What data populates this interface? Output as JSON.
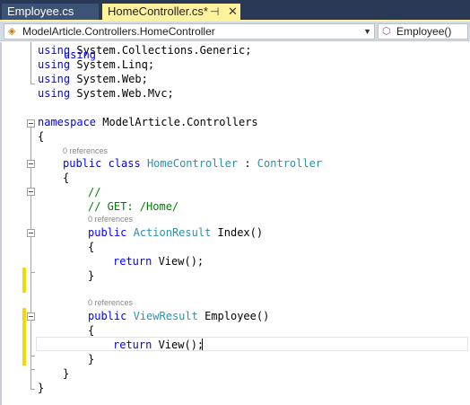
{
  "tabs": [
    {
      "label": "Employee.cs",
      "active": false
    },
    {
      "label": "HomeController.cs*",
      "active": true,
      "pin_glyph": "⊣",
      "close_glyph": "✕"
    }
  ],
  "navbar": {
    "class_combo": {
      "text": "ModelArticle.Controllers.HomeController",
      "icon": "class-icon"
    },
    "member_combo": {
      "text": "Employee()",
      "icon": "method-icon"
    }
  },
  "colors": {
    "keyword": "#0000ff",
    "type": "#2b91af",
    "comment": "#008000",
    "text": "#000000",
    "annotation": "#888888",
    "tab_active": "#fff29d",
    "tab_strip": "#293955",
    "change_bar": "#efdb00"
  },
  "editor": {
    "code": {
      "using1": {
        "kw": "using",
        "rest": " System.Collections.Generic;"
      },
      "using2": {
        "kw": "using",
        "rest": " System.Linq;"
      },
      "using3": {
        "kw": "using",
        "rest": " System.Web;"
      },
      "using4": {
        "kw": "using",
        "rest": " System.Web.Mvc;"
      },
      "ns": {
        "kw": "namespace",
        "rest": " ModelArticle.Controllers"
      },
      "ns_open": "{",
      "class": {
        "kw1": "public",
        "kw2": " class",
        "name": "HomeController",
        "sep": " : ",
        "base": "Controller"
      },
      "class_open": "{",
      "comment1": "//",
      "comment2": "// GET: /Home/",
      "index_sig": {
        "kw": "public",
        "type": "ActionResult",
        "rest": " Index()"
      },
      "index_open": "{",
      "index_return": {
        "kw": "return",
        "rest": " View();"
      },
      "index_close": "}",
      "emp_sig": {
        "kw": "public",
        "type": "ViewResult",
        "rest": " Employee()"
      },
      "emp_open": "{",
      "emp_return": {
        "kw": "return",
        "rest": " View();"
      },
      "emp_close": "}",
      "class_close": "}",
      "ns_close": "}"
    },
    "references": [
      "0 references",
      "0 references",
      "0 references"
    ]
  }
}
